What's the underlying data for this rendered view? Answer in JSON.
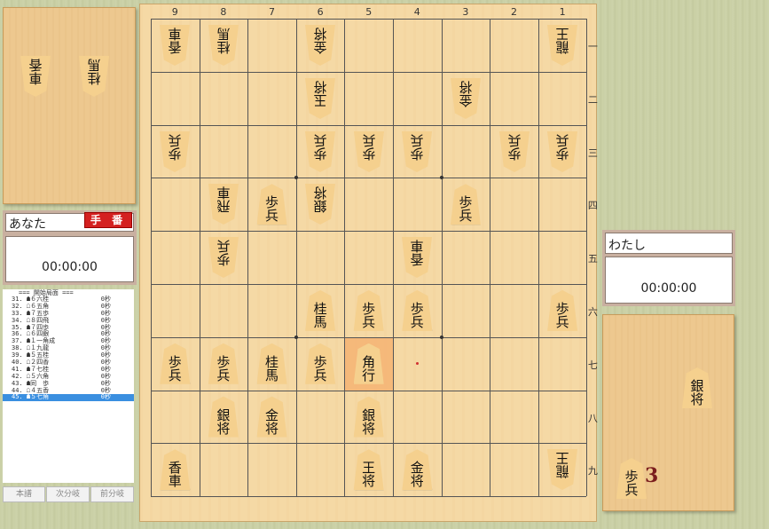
{
  "top_player": {
    "name": "あなた",
    "turn_badge": "手 番",
    "clock": "00:00:00",
    "hand": [
      {
        "piece": "車",
        "sub": "香"
      },
      {
        "piece": "桂",
        "sub": "馬"
      }
    ]
  },
  "bottom_player": {
    "name": "わたし",
    "clock": "00:00:00",
    "hand": [
      {
        "piece": "銀",
        "sub": "将"
      },
      {
        "piece": "歩",
        "sub": "兵",
        "count": "3"
      }
    ]
  },
  "board": {
    "files": [
      "9",
      "8",
      "7",
      "6",
      "5",
      "4",
      "3",
      "2",
      "1"
    ],
    "ranks": [
      "一",
      "二",
      "三",
      "四",
      "五",
      "六",
      "七",
      "八",
      "九"
    ],
    "pieces": [
      {
        "file": 9,
        "rank": 1,
        "top": "香",
        "bottom": "車",
        "side": "gote"
      },
      {
        "file": 8,
        "rank": 1,
        "top": "桂",
        "bottom": "馬",
        "side": "gote"
      },
      {
        "file": 6,
        "rank": 1,
        "top": "金",
        "bottom": "将",
        "side": "gote"
      },
      {
        "file": 1,
        "rank": 1,
        "top": "龍",
        "bottom": "王",
        "side": "gote"
      },
      {
        "file": 6,
        "rank": 2,
        "top": "玉",
        "bottom": "将",
        "side": "gote"
      },
      {
        "file": 3,
        "rank": 2,
        "top": "金",
        "bottom": "将",
        "side": "gote"
      },
      {
        "file": 9,
        "rank": 3,
        "top": "歩",
        "bottom": "兵",
        "side": "gote"
      },
      {
        "file": 6,
        "rank": 3,
        "top": "歩",
        "bottom": "兵",
        "side": "gote"
      },
      {
        "file": 5,
        "rank": 3,
        "top": "歩",
        "bottom": "兵",
        "side": "gote"
      },
      {
        "file": 4,
        "rank": 3,
        "top": "歩",
        "bottom": "兵",
        "side": "gote"
      },
      {
        "file": 2,
        "rank": 3,
        "top": "歩",
        "bottom": "兵",
        "side": "gote"
      },
      {
        "file": 1,
        "rank": 3,
        "top": "歩",
        "bottom": "兵",
        "side": "gote"
      },
      {
        "file": 8,
        "rank": 4,
        "top": "飛",
        "bottom": "車",
        "side": "gote"
      },
      {
        "file": 7,
        "rank": 4,
        "top": "歩",
        "bottom": "兵",
        "side": "sente"
      },
      {
        "file": 6,
        "rank": 4,
        "top": "銀",
        "bottom": "将",
        "side": "gote"
      },
      {
        "file": 3,
        "rank": 4,
        "top": "歩",
        "bottom": "兵",
        "side": "sente"
      },
      {
        "file": 8,
        "rank": 5,
        "top": "歩",
        "bottom": "兵",
        "side": "gote"
      },
      {
        "file": 4,
        "rank": 5,
        "top": "香",
        "bottom": "車",
        "side": "gote"
      },
      {
        "file": 6,
        "rank": 6,
        "top": "桂",
        "bottom": "馬",
        "side": "sente"
      },
      {
        "file": 5,
        "rank": 6,
        "top": "歩",
        "bottom": "兵",
        "side": "sente"
      },
      {
        "file": 4,
        "rank": 6,
        "top": "歩",
        "bottom": "兵",
        "side": "sente"
      },
      {
        "file": 1,
        "rank": 6,
        "top": "歩",
        "bottom": "兵",
        "side": "sente"
      },
      {
        "file": 9,
        "rank": 7,
        "top": "歩",
        "bottom": "兵",
        "side": "sente"
      },
      {
        "file": 8,
        "rank": 7,
        "top": "歩",
        "bottom": "兵",
        "side": "sente"
      },
      {
        "file": 7,
        "rank": 7,
        "top": "桂",
        "bottom": "馬",
        "side": "sente"
      },
      {
        "file": 6,
        "rank": 7,
        "top": "歩",
        "bottom": "兵",
        "side": "sente"
      },
      {
        "file": 5,
        "rank": 7,
        "top": "角",
        "bottom": "行",
        "side": "sente",
        "highlight": true
      },
      {
        "file": 8,
        "rank": 8,
        "top": "銀",
        "bottom": "将",
        "side": "sente"
      },
      {
        "file": 7,
        "rank": 8,
        "top": "金",
        "bottom": "将",
        "side": "sente"
      },
      {
        "file": 5,
        "rank": 8,
        "top": "銀",
        "bottom": "将",
        "side": "sente"
      },
      {
        "file": 9,
        "rank": 9,
        "top": "香",
        "bottom": "車",
        "side": "sente"
      },
      {
        "file": 5,
        "rank": 9,
        "top": "王",
        "bottom": "将",
        "side": "sente"
      },
      {
        "file": 4,
        "rank": 9,
        "top": "金",
        "bottom": "将",
        "side": "sente"
      },
      {
        "file": 1,
        "rank": 9,
        "top": "龍",
        "bottom": "王",
        "side": "gote"
      }
    ]
  },
  "kifu": {
    "header": "=== 開始局面 ===",
    "moves": [
      {
        "n": "31.",
        "m": "☗６六桂",
        "t": "0秒"
      },
      {
        "n": "32.",
        "m": "☖６五角",
        "t": "0秒"
      },
      {
        "n": "33.",
        "m": "☗７五歩",
        "t": "0秒"
      },
      {
        "n": "34.",
        "m": "☖８四飛",
        "t": "0秒"
      },
      {
        "n": "35.",
        "m": "☗７四歩",
        "t": "0秒"
      },
      {
        "n": "36.",
        "m": "☖６四銀",
        "t": "0秒"
      },
      {
        "n": "37.",
        "m": "☗１一角成",
        "t": "0秒"
      },
      {
        "n": "38.",
        "m": "☖１九龍",
        "t": "0秒"
      },
      {
        "n": "39.",
        "m": "☗５五桂",
        "t": "0秒"
      },
      {
        "n": "40.",
        "m": "☖２四香",
        "t": "0秒"
      },
      {
        "n": "41.",
        "m": "☗７七桂",
        "t": "0秒"
      },
      {
        "n": "42.",
        "m": "☖５六角",
        "t": "0秒"
      },
      {
        "n": "43.",
        "m": "☗同　歩",
        "t": "0秒"
      },
      {
        "n": "44.",
        "m": "☖４五香",
        "t": "0秒"
      },
      {
        "n": "45.",
        "m": "☗５七角",
        "t": "0秒",
        "selected": true
      }
    ],
    "buttons": [
      "本譜",
      "次分岐",
      "前分岐"
    ]
  }
}
